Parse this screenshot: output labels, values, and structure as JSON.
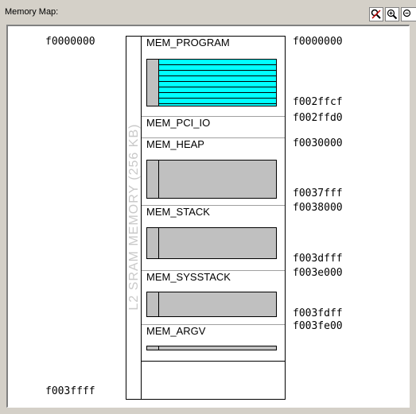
{
  "window": {
    "title": "Memory Map:"
  },
  "toolbar": {
    "icons": [
      "zoom-reset-icon",
      "zoom-in-icon",
      "zoom-out-icon"
    ]
  },
  "map": {
    "start_address": "f0000000",
    "end_address": "f003ffff",
    "memory_label": "L2 SRAM MEMORY (256 KB)",
    "sections": [
      {
        "name": "MEM_PROGRAM",
        "start": "f0000000",
        "end": "f002ffcf"
      },
      {
        "name": "MEM_PCI_IO",
        "start": "f002ffd0"
      },
      {
        "name": "MEM_HEAP",
        "start": "f0030000",
        "end": "f0037fff"
      },
      {
        "name": "MEM_STACK",
        "start": "f0038000",
        "end": "f003dfff"
      },
      {
        "name": "MEM_SYSSTACK",
        "start": "f003e000",
        "end": "f003fdff"
      },
      {
        "name": "MEM_ARGV",
        "start": "f003fe00"
      }
    ]
  },
  "colors": {
    "program_fill": "#00ffff",
    "bar_fill": "#c0c0c0",
    "panel_bg": "#ffffff",
    "chrome": "#d4d0c8"
  }
}
